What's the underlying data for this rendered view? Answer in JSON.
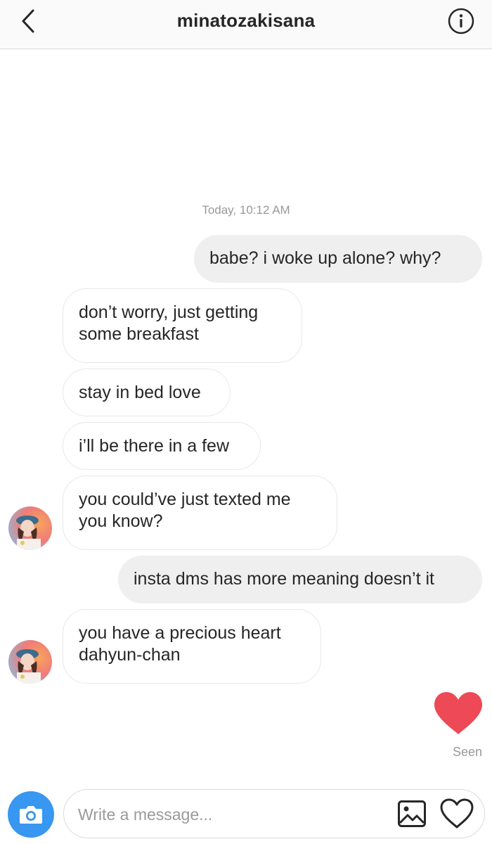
{
  "header": {
    "title": "minatozakisana",
    "back_icon": "chevron-left-icon",
    "info_icon": "info-icon"
  },
  "conversation": {
    "timestamp": "Today, 10:12 AM",
    "messages": [
      {
        "direction": "out",
        "lines": [
          "babe? i woke up alone? why?"
        ]
      },
      {
        "direction": "in",
        "lines": [
          "don’t worry, just getting",
          "some breakfast"
        ]
      },
      {
        "direction": "in",
        "lines": [
          "stay in bed love"
        ]
      },
      {
        "direction": "in",
        "lines": [
          "i’ll be there in a few"
        ]
      },
      {
        "direction": "in",
        "lines": [
          "you could’ve just texted me",
          "you know?"
        ]
      },
      {
        "direction": "out",
        "lines": [
          "insta dms has more meaning doesn’t it"
        ]
      },
      {
        "direction": "in",
        "lines": [
          "you have a precious heart",
          "dahyun-chan"
        ]
      }
    ],
    "liked_reaction_icon": "heart-filled-icon",
    "seen_label": "Seen"
  },
  "composer": {
    "placeholder": "Write a message...",
    "value": "",
    "camera_icon": "camera-icon",
    "gallery_icon": "image-icon",
    "heart_icon": "heart-outline-icon"
  },
  "colors": {
    "accent_blue": "#3897f0",
    "heart_red": "#ed4956",
    "outgoing_bubble": "#efefef",
    "incoming_border": "#e8e8e8",
    "meta_gray": "#999999"
  }
}
